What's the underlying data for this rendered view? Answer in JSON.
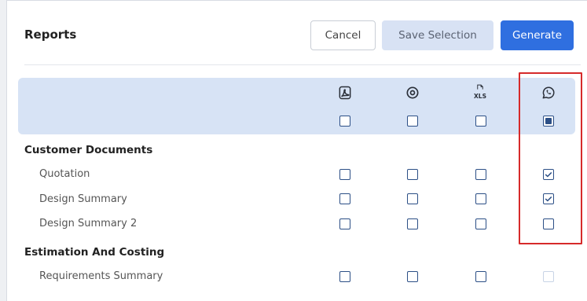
{
  "header": {
    "title": "Reports",
    "cancel_label": "Cancel",
    "save_label": "Save Selection",
    "generate_label": "Generate"
  },
  "columns": [
    {
      "icon": "pdf-icon"
    },
    {
      "icon": "eye-icon"
    },
    {
      "icon": "xls-icon",
      "icon_text": "XLS"
    },
    {
      "icon": "whatsapp-icon"
    }
  ],
  "select_all": [
    "unchecked",
    "unchecked",
    "unchecked",
    "indeterminate"
  ],
  "sections": [
    {
      "title": "Customer Documents",
      "rows": [
        {
          "label": "Quotation",
          "states": [
            "unchecked",
            "unchecked",
            "unchecked",
            "checked"
          ]
        },
        {
          "label": "Design Summary",
          "states": [
            "unchecked",
            "unchecked",
            "unchecked",
            "checked"
          ]
        },
        {
          "label": "Design Summary 2",
          "states": [
            "unchecked",
            "unchecked",
            "unchecked",
            "unchecked"
          ]
        }
      ]
    },
    {
      "title": "Estimation And Costing",
      "rows": [
        {
          "label": "Requirements Summary",
          "states": [
            "unchecked",
            "unchecked",
            "unchecked",
            "disabled"
          ]
        }
      ]
    }
  ],
  "colors": {
    "accent": "#2f6fe0",
    "header_band": "#d7e3f5",
    "checkbox_border": "#2c4f86",
    "highlight": "#d62a2a"
  }
}
